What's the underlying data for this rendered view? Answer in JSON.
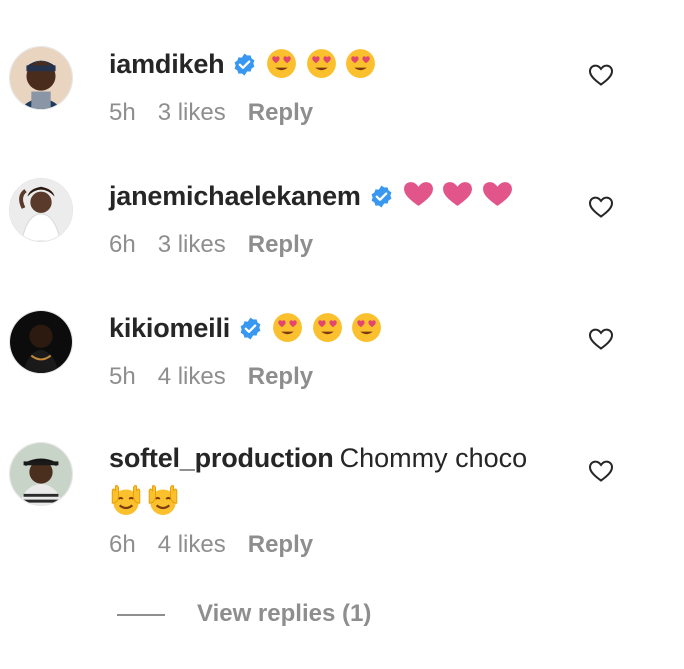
{
  "comments": [
    {
      "username": "iamdikeh",
      "text": "",
      "verified": true,
      "emoji": [
        "smiling-face-with-heart-eyes",
        "smiling-face-with-heart-eyes",
        "smiling-face-with-heart-eyes"
      ],
      "time": "5h",
      "likes": "3 likes",
      "reply": "Reply"
    },
    {
      "username": "janemichaelekanem",
      "text": "",
      "verified": true,
      "emoji": [
        "pink-heart",
        "pink-heart",
        "pink-heart"
      ],
      "time": "6h",
      "likes": "3 likes",
      "reply": "Reply"
    },
    {
      "username": "kikiomeili",
      "text": "",
      "verified": true,
      "emoji": [
        "smiling-face-with-heart-eyes",
        "smiling-face-with-heart-eyes",
        "smiling-face-with-heart-eyes"
      ],
      "time": "5h",
      "likes": "4 likes",
      "reply": "Reply"
    },
    {
      "username": "softel_production",
      "text": "Chommy choco",
      "verified": false,
      "emoji": [
        "raising-hands",
        "raising-hands"
      ],
      "time": "6h",
      "likes": "4 likes",
      "reply": "Reply"
    }
  ],
  "view_replies": "View replies (1)",
  "colors": {
    "text": "#262626",
    "secondary": "#8e8e8e",
    "verified_blue": "#3897f0",
    "emoji_yellow": "#fbc02d",
    "heart_pink": "#e2558b"
  },
  "icons": {
    "like": "heart-outline-icon",
    "verified": "verified-badge-icon"
  }
}
